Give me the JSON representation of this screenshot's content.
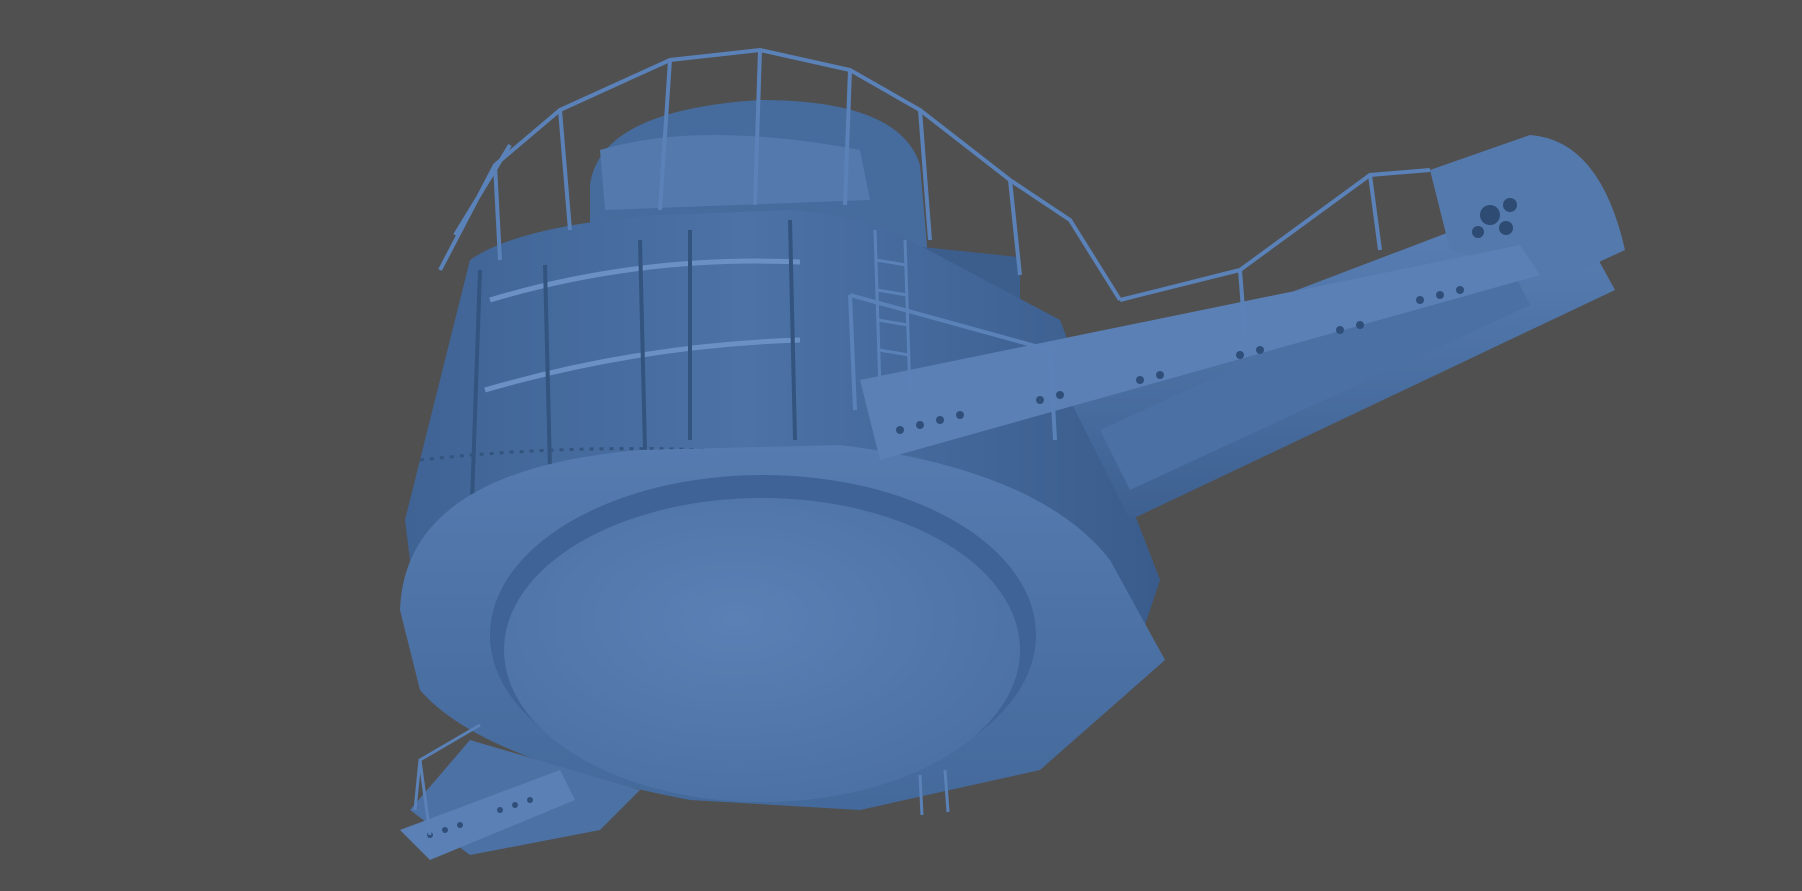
{
  "viewport": {
    "background_color": "#505050"
  },
  "scene": {
    "subject": "3d-model-render-turret",
    "model_color": "#4a6fa0",
    "highlight_color": "#6e92c2",
    "shadow_color": "#2f4f7a",
    "railing_color": "#5a82b8"
  }
}
